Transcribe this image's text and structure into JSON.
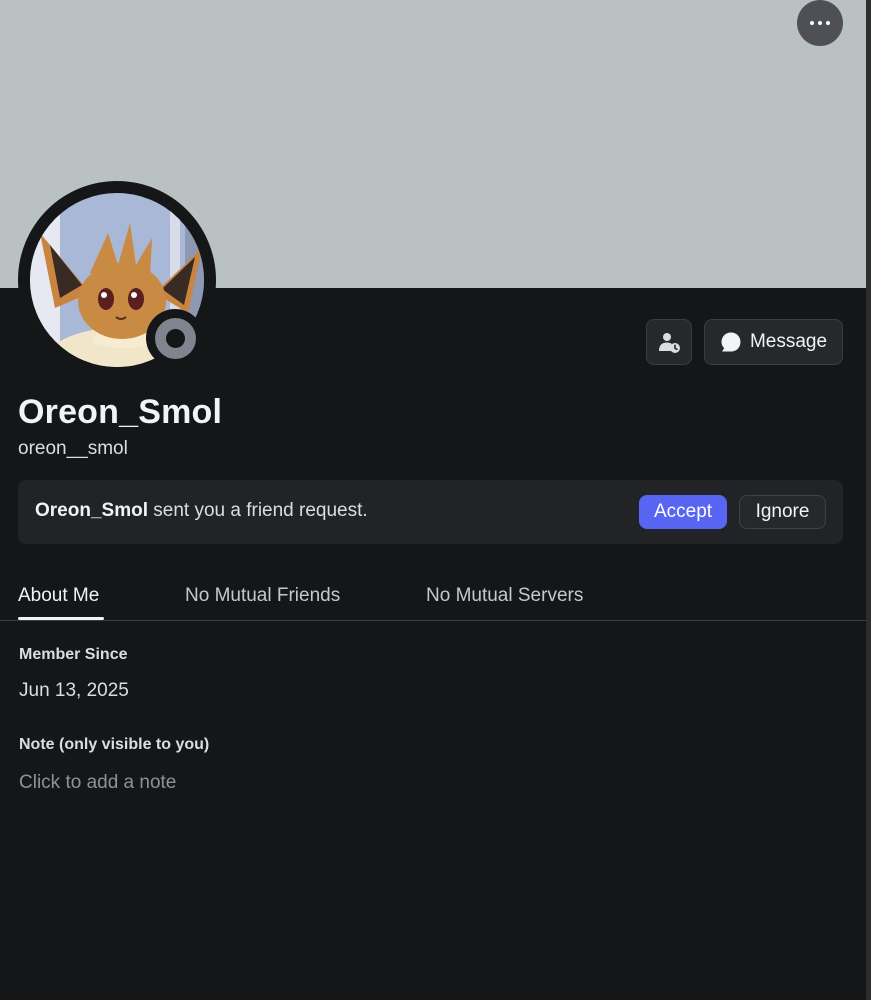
{
  "colors": {
    "banner": "#b9c2c1",
    "background": "#151618",
    "accent": "#5865f2",
    "status_idle_offline": "#80848e"
  },
  "icons": {
    "more": "more-horizontal-icon",
    "pending": "pending-friend-request-icon",
    "message": "chat-bubble-icon",
    "status": "offline-status-icon"
  },
  "profile": {
    "display_name": "Oreon_Smol",
    "username": "oreon__smol",
    "status": "offline"
  },
  "actions": {
    "message_label": "Message"
  },
  "friend_request": {
    "sender": "Oreon_Smol",
    "text": "sent you a friend request.",
    "accept_label": "Accept",
    "ignore_label": "Ignore"
  },
  "tabs": [
    {
      "label": "About Me",
      "active": true
    },
    {
      "label": "No Mutual Friends",
      "active": false
    },
    {
      "label": "No Mutual Servers",
      "active": false
    }
  ],
  "about": {
    "member_since_title": "Member Since",
    "member_since_value": "Jun 13, 2025",
    "note_title": "Note (only visible to you)",
    "note_placeholder": "Click to add a note",
    "note_value": ""
  }
}
